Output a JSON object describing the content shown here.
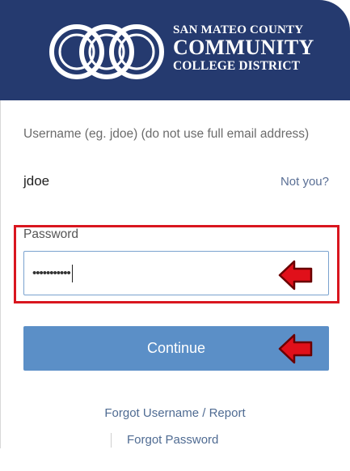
{
  "logo": {
    "line1": "SAN MATEO COUNTY",
    "line2": "COMMUNITY",
    "line3": "COLLEGE DISTRICT",
    "icon": "interlocking-rings-logo-icon"
  },
  "form": {
    "username_label": "Username (eg. jdoe) (do not use full email address)",
    "username_value": "jdoe",
    "not_you_link": "Not you?",
    "password_label": "Password",
    "password_masked": "•••••••••••",
    "continue_label": "Continue",
    "forgot_username_link": "Forgot Username / Report",
    "forgot_password_link": "Forgot Password"
  },
  "colors": {
    "header_bg": "#253a6f",
    "button_bg": "#5b8fc7",
    "highlight_border": "#d9161f",
    "annotation_arrow": "#e0101a",
    "link": "#4f6b92"
  }
}
